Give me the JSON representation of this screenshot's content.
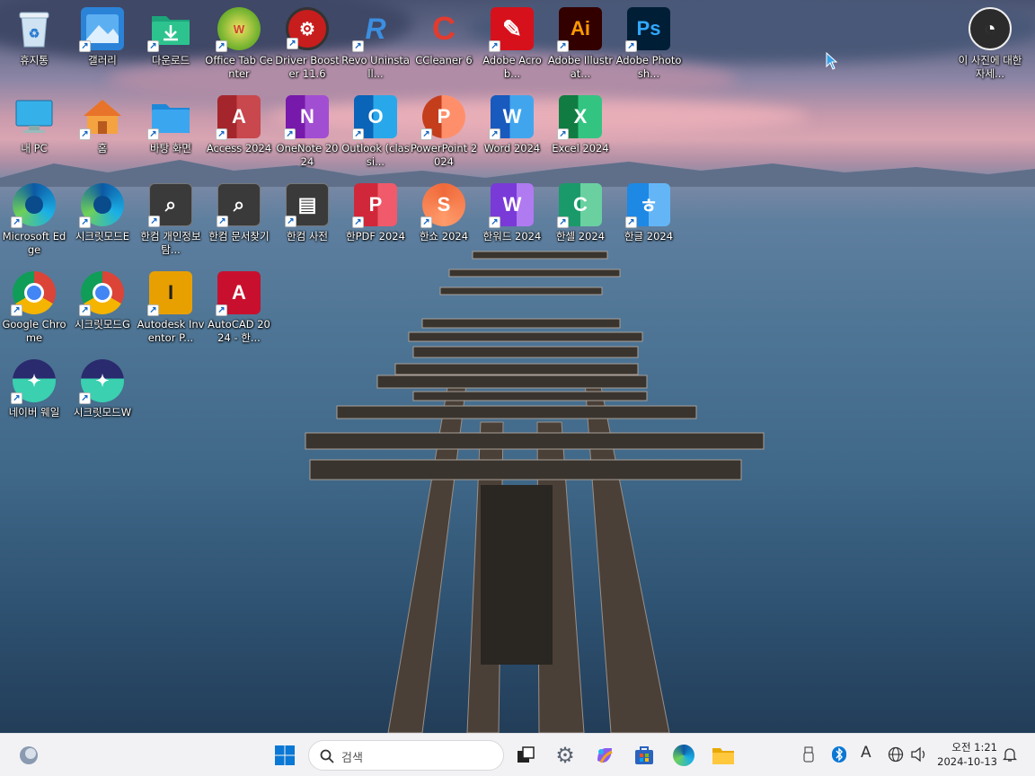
{
  "desktop": {
    "icons": [
      {
        "label": "휴지통",
        "icon": "recycle-bin-icon"
      },
      {
        "label": "갤러리",
        "icon": "gallery-icon"
      },
      {
        "label": "다운로드",
        "icon": "downloads-folder-icon"
      },
      {
        "label": "Office Tab Center",
        "icon": "office-tab-icon"
      },
      {
        "label": "Driver Booster 11.6",
        "icon": "driver-booster-icon"
      },
      {
        "label": "Revo Uninstall...",
        "icon": "revo-uninstaller-icon"
      },
      {
        "label": "CCleaner 6",
        "icon": "ccleaner-icon"
      },
      {
        "label": "Adobe Acrob...",
        "icon": "adobe-acrobat-icon"
      },
      {
        "label": "Adobe Illustrat...",
        "icon": "adobe-illustrator-icon"
      },
      {
        "label": "Adobe Photosh...",
        "icon": "adobe-photoshop-icon"
      },
      {
        "label": "이 사진에 대한 자세...",
        "icon": "learn-about-picture-icon"
      },
      {
        "label": "내 PC",
        "icon": "this-pc-icon"
      },
      {
        "label": "홈",
        "icon": "home-icon"
      },
      {
        "label": "바탕 화면",
        "icon": "desktop-folder-icon"
      },
      {
        "label": "Access 2024",
        "icon": "access-icon"
      },
      {
        "label": "OneNote 2024",
        "icon": "onenote-icon"
      },
      {
        "label": "Outlook (classi...",
        "icon": "outlook-icon"
      },
      {
        "label": "PowerPoint 2024",
        "icon": "powerpoint-icon"
      },
      {
        "label": "Word 2024",
        "icon": "word-icon"
      },
      {
        "label": "Excel 2024",
        "icon": "excel-icon"
      },
      {
        "label": "Microsoft Edge",
        "icon": "edge-icon"
      },
      {
        "label": "시크릿모드E",
        "icon": "edge-incognito-icon"
      },
      {
        "label": "한컴 개인정보탐...",
        "icon": "hancom-privacy-icon"
      },
      {
        "label": "한컴 문서찾기",
        "icon": "hancom-docsearch-icon"
      },
      {
        "label": "한컴 사전",
        "icon": "hancom-dictionary-icon"
      },
      {
        "label": "한PDF 2024",
        "icon": "hanpdf-icon"
      },
      {
        "label": "한쇼 2024",
        "icon": "hanshow-icon"
      },
      {
        "label": "한워드 2024",
        "icon": "hanword-icon"
      },
      {
        "label": "한셀 2024",
        "icon": "hancell-icon"
      },
      {
        "label": "한글 2024",
        "icon": "hangul-icon"
      },
      {
        "label": "Google Chrome",
        "icon": "chrome-icon"
      },
      {
        "label": "시크릿모드G",
        "icon": "chrome-incognito-icon"
      },
      {
        "label": "Autodesk Inventor P...",
        "icon": "inventor-icon"
      },
      {
        "label": "AutoCAD 2024 - 한...",
        "icon": "autocad-icon"
      },
      {
        "label": "네이버 웨일",
        "icon": "whale-icon"
      },
      {
        "label": "시크릿모드W",
        "icon": "whale-incognito-icon"
      }
    ]
  },
  "taskbar": {
    "search_placeholder": "검색",
    "apps": [
      "widgets-icon",
      "start-icon",
      "task-view-icon",
      "settings-icon",
      "copilot-icon",
      "store-icon",
      "edge-icon",
      "file-explorer-icon"
    ],
    "tray": [
      "usb-icon",
      "bluetooth-icon",
      "ime-icon",
      "network-icon",
      "volume-icon",
      "notification-bell-icon"
    ],
    "ime_label": "A",
    "clock_time": "오전 1:21",
    "clock_date": "2024-10-13"
  }
}
